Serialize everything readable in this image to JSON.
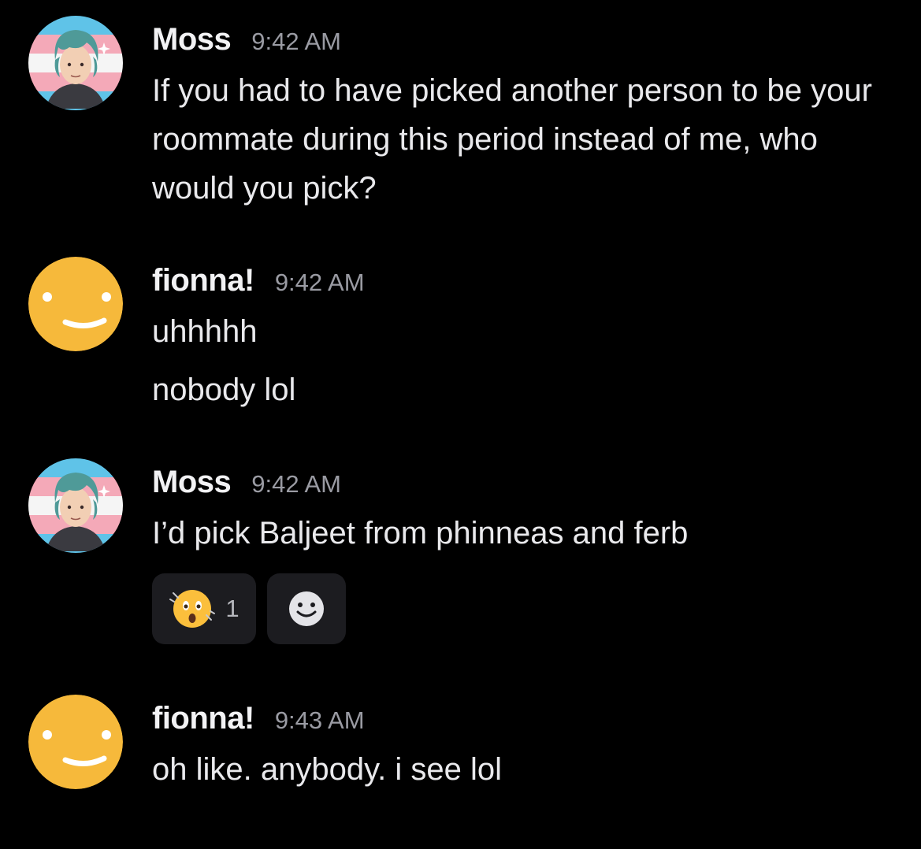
{
  "messages": [
    {
      "author": "Moss",
      "time": "9:42 AM",
      "avatar": "moss-avatar",
      "lines": [
        "If you had to have picked another person to be your roommate during this period instead of me, who would you pick?"
      ]
    },
    {
      "author": "fionna!",
      "time": "9:42 AM",
      "avatar": "smiley-avatar",
      "lines": [
        "uhhhhh",
        "nobody lol"
      ]
    },
    {
      "author": "Moss",
      "time": "9:42 AM",
      "avatar": "moss-avatar",
      "lines": [
        "I’d pick Baljeet from phinneas and ferb"
      ],
      "reactions": [
        {
          "emoji": "astonished-face",
          "count": "1"
        },
        {
          "emoji": "add-reaction-icon"
        }
      ]
    },
    {
      "author": "fionna!",
      "time": "9:43 AM",
      "avatar": "smiley-avatar",
      "lines": [
        "oh like. anybody. i see lol"
      ]
    }
  ],
  "colors": {
    "background": "#000000",
    "smiley_avatar": "#f6b93b",
    "timestamp": "#9a9ba3",
    "reaction_bg": "#1c1c20"
  }
}
